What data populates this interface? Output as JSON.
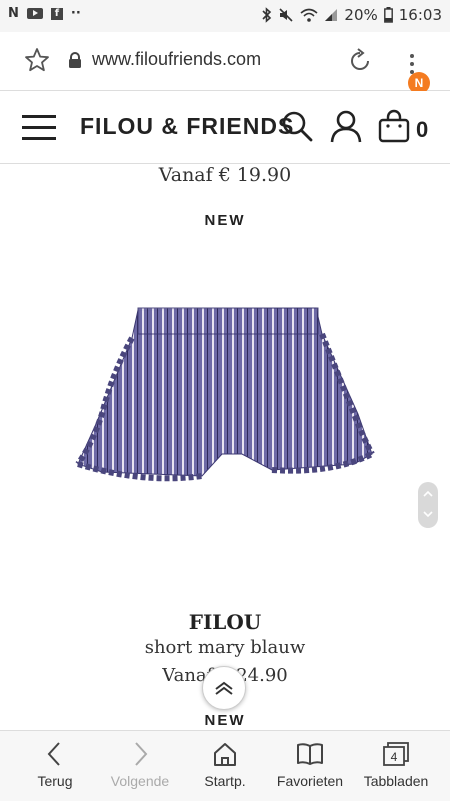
{
  "status_bar": {
    "left_icons": [
      "N",
      "youtube-icon",
      "facebook-icon",
      "··"
    ],
    "battery": "20%",
    "time": "16:03"
  },
  "browser": {
    "url": "www.filoufriends.com",
    "account_badge": "N"
  },
  "site": {
    "logo": "FILOU & FRIENDS",
    "cart_count": "0"
  },
  "products": [
    {
      "price": "Vanaf € 19.90"
    },
    {
      "tag": "NEW",
      "brand": "FILOU",
      "name": "short mary blauw",
      "price": "Vanaf € 24.90",
      "next_tag": "NEW",
      "image_color": "#6e6aa6"
    }
  ],
  "bottom_nav": [
    {
      "label": "Terug",
      "icon": "back-icon"
    },
    {
      "label": "Volgende",
      "icon": "forward-icon"
    },
    {
      "label": "Startp.",
      "icon": "home-icon"
    },
    {
      "label": "Favorieten",
      "icon": "bookmark-icon"
    },
    {
      "label": "Tabbladen",
      "icon": "tabs-icon",
      "count": "4"
    }
  ]
}
